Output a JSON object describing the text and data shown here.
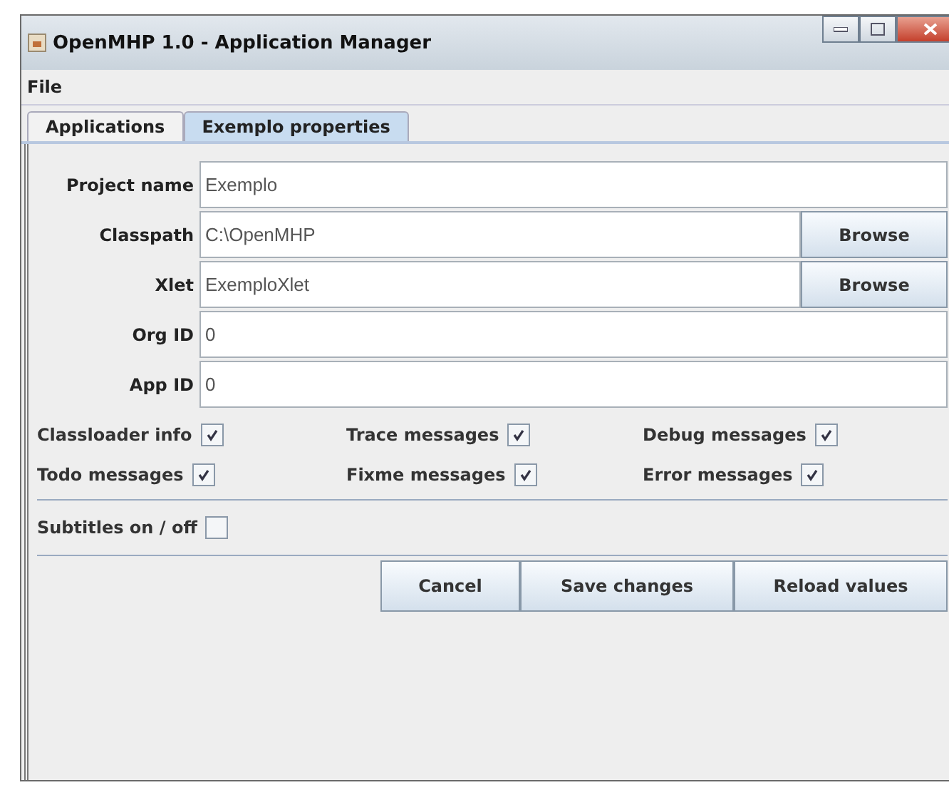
{
  "window": {
    "title": "OpenMHP 1.0 - Application Manager"
  },
  "menu": [
    "File"
  ],
  "tabs": [
    {
      "label": "Applications",
      "selected": false
    },
    {
      "label": "Exemplo properties",
      "selected": true
    }
  ],
  "fields": [
    {
      "label": "Project name",
      "value": "Exemplo"
    },
    {
      "label": "Classpath",
      "value": "C:\\OpenMHP",
      "browse": "Browse"
    },
    {
      "label": "Xlet",
      "value": "ExemploXlet",
      "browse": "Browse"
    },
    {
      "label": "Org ID",
      "value": "0"
    },
    {
      "label": "App ID",
      "value": "0"
    }
  ],
  "options": [
    {
      "label": "Classloader info",
      "checked": true
    },
    {
      "label": "Trace messages",
      "checked": true
    },
    {
      "label": "Debug messages",
      "checked": true
    },
    {
      "label": "Todo messages",
      "checked": true
    },
    {
      "label": "Fixme messages",
      "checked": true
    },
    {
      "label": "Error messages",
      "checked": true
    }
  ],
  "subtitles": {
    "label": "Subtitles on / off",
    "checked": false
  },
  "buttons": [
    "Cancel",
    "Save changes",
    "Reload values"
  ]
}
